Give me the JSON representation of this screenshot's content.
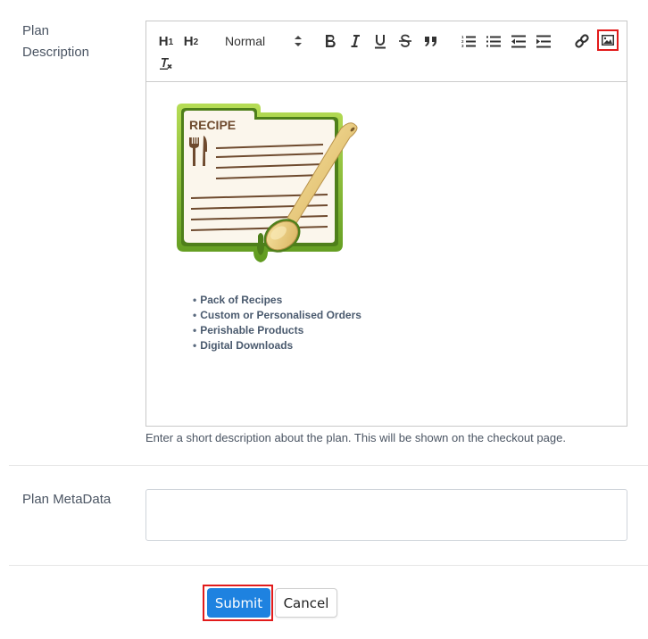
{
  "form": {
    "description_label_line1": "Plan",
    "description_label_line2": "Description",
    "metadata_label": "Plan MetaData",
    "help_text": "Enter a short description about the plan. This will be shown on the checkout page.",
    "metadata_value": "",
    "highlight_color": "#e21b1b"
  },
  "toolbar": {
    "h1_label": "H",
    "h1_sub": "1",
    "h2_label": "H",
    "h2_sub": "2",
    "format_select": "Normal",
    "icons": [
      "bold-icon",
      "italic-icon",
      "underline-icon",
      "strikethrough-icon",
      "blockquote-icon",
      "ordered-list-icon",
      "bullet-list-icon",
      "outdent-icon",
      "indent-icon",
      "link-icon",
      "image-icon",
      "clear-format-icon"
    ]
  },
  "editor": {
    "image_caption": "RECIPE",
    "bullets": [
      "Pack of Recipes",
      "Custom or Personalised Orders",
      "Perishable Products",
      "Digital Downloads"
    ]
  },
  "actions": {
    "submit_label": "Submit",
    "cancel_label": "Cancel",
    "submit_color": "#1e82e0"
  }
}
